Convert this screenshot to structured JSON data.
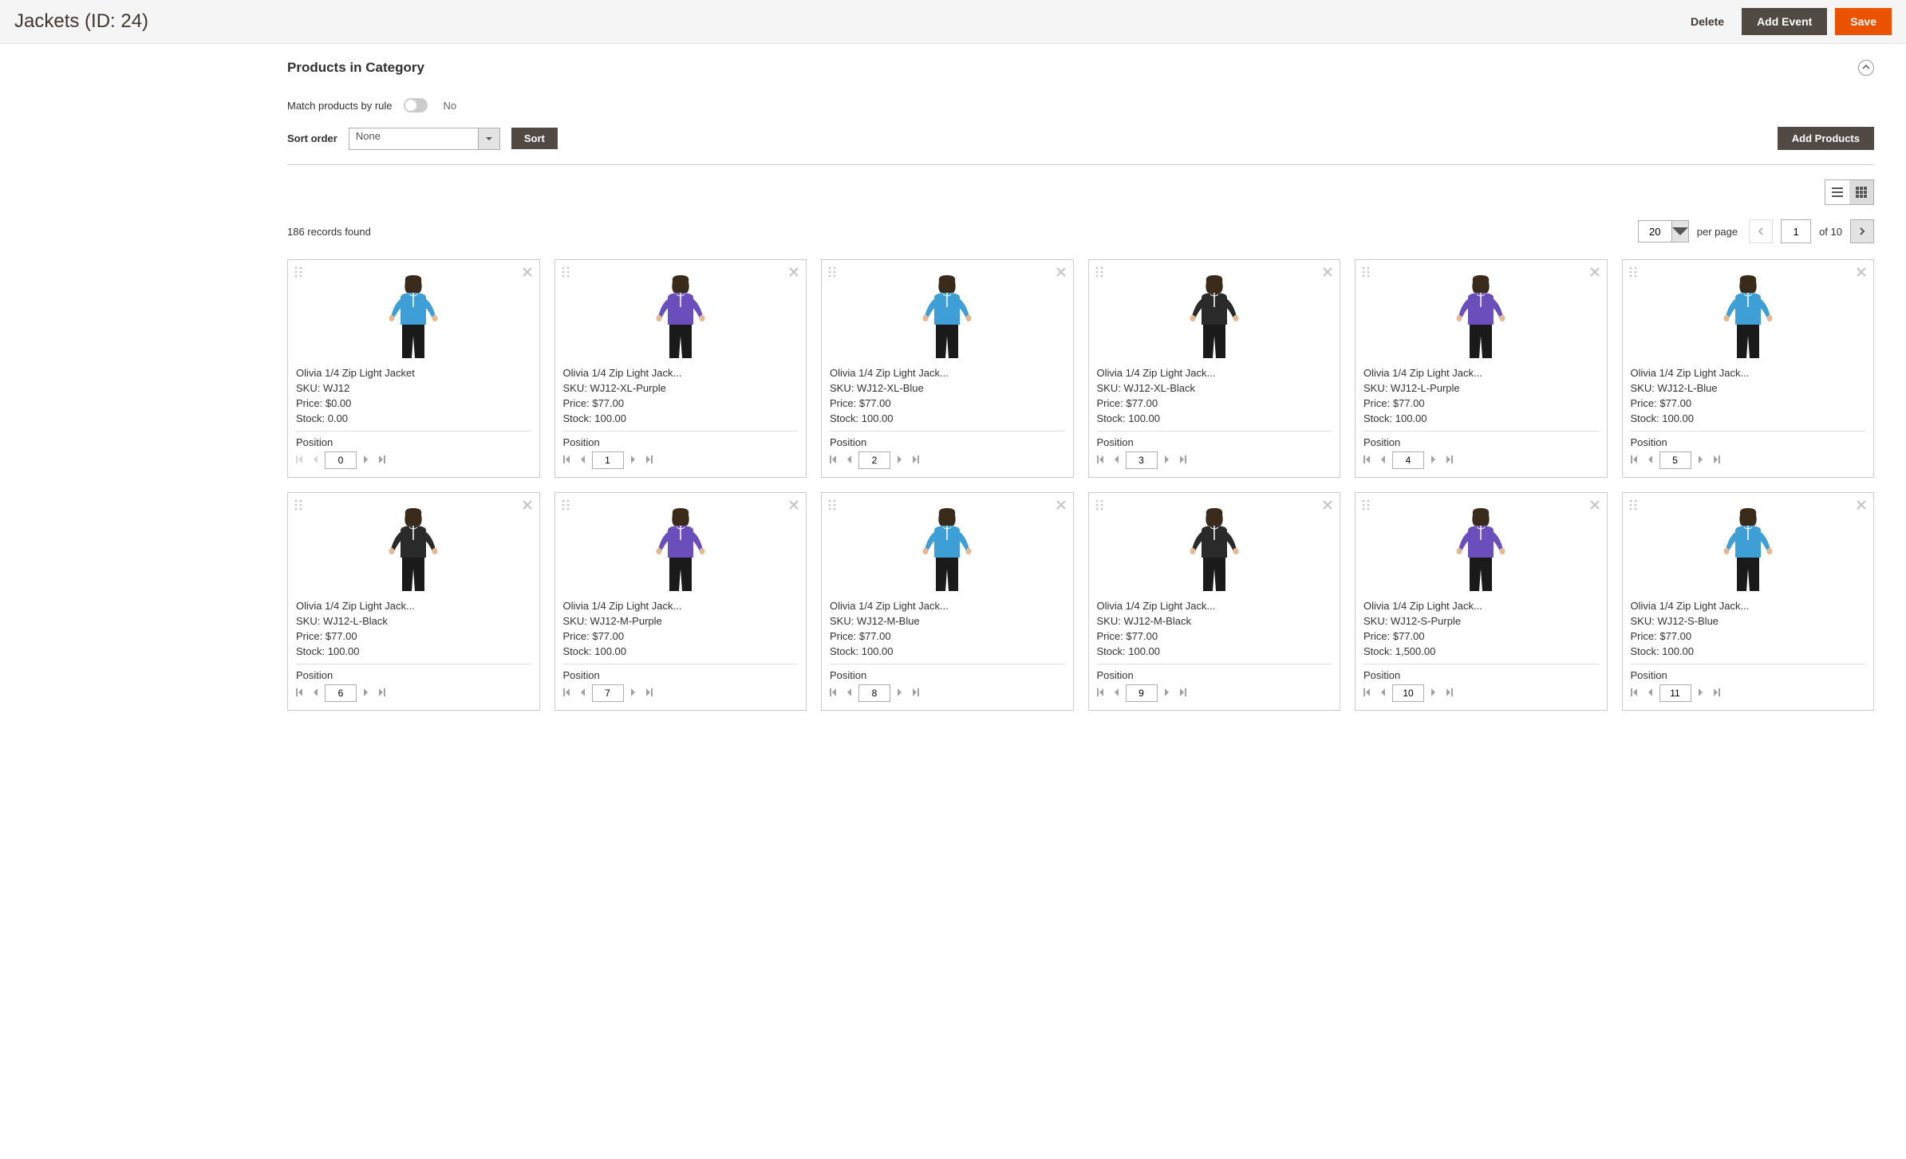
{
  "header": {
    "title": "Jackets (ID: 24)",
    "delete_label": "Delete",
    "add_event_label": "Add Event",
    "save_label": "Save"
  },
  "section": {
    "title": "Products in Category",
    "match_rule_label": "Match products by rule",
    "match_rule_value": "No",
    "sort_order_label": "Sort order",
    "sort_order_value": "None",
    "sort_button": "Sort",
    "add_products_button": "Add Products"
  },
  "pager": {
    "records_found": "186 records found",
    "per_page_value": "20",
    "per_page_label": "per page",
    "current_page": "1",
    "total_pages": "10",
    "of_label": "of"
  },
  "labels": {
    "sku_prefix": "SKU: ",
    "price_prefix": "Price: ",
    "stock_prefix": "Stock: ",
    "position_label": "Position"
  },
  "colors": {
    "blue": "#3d9fd6",
    "purple": "#6a4fbc",
    "black": "#2a2a2a",
    "skin": "#e6b890",
    "hair": "#3a2a1a",
    "pants": "#1a1a1a"
  },
  "products": [
    {
      "name": "Olivia 1/4 Zip Light Jacket",
      "sku": "WJ12",
      "price": "$0.00",
      "stock": "0.00",
      "position": "0",
      "color": "blue"
    },
    {
      "name": "Olivia 1/4 Zip Light Jack...",
      "sku": "WJ12-XL-Purple",
      "price": "$77.00",
      "stock": "100.00",
      "position": "1",
      "color": "purple"
    },
    {
      "name": "Olivia 1/4 Zip Light Jack...",
      "sku": "WJ12-XL-Blue",
      "price": "$77.00",
      "stock": "100.00",
      "position": "2",
      "color": "blue"
    },
    {
      "name": "Olivia 1/4 Zip Light Jack...",
      "sku": "WJ12-XL-Black",
      "price": "$77.00",
      "stock": "100.00",
      "position": "3",
      "color": "black"
    },
    {
      "name": "Olivia 1/4 Zip Light Jack...",
      "sku": "WJ12-L-Purple",
      "price": "$77.00",
      "stock": "100.00",
      "position": "4",
      "color": "purple"
    },
    {
      "name": "Olivia 1/4 Zip Light Jack...",
      "sku": "WJ12-L-Blue",
      "price": "$77.00",
      "stock": "100.00",
      "position": "5",
      "color": "blue"
    },
    {
      "name": "Olivia 1/4 Zip Light Jack...",
      "sku": "WJ12-L-Black",
      "price": "$77.00",
      "stock": "100.00",
      "position": "6",
      "color": "black"
    },
    {
      "name": "Olivia 1/4 Zip Light Jack...",
      "sku": "WJ12-M-Purple",
      "price": "$77.00",
      "stock": "100.00",
      "position": "7",
      "color": "purple"
    },
    {
      "name": "Olivia 1/4 Zip Light Jack...",
      "sku": "WJ12-M-Blue",
      "price": "$77.00",
      "stock": "100.00",
      "position": "8",
      "color": "blue"
    },
    {
      "name": "Olivia 1/4 Zip Light Jack...",
      "sku": "WJ12-M-Black",
      "price": "$77.00",
      "stock": "100.00",
      "position": "9",
      "color": "black"
    },
    {
      "name": "Olivia 1/4 Zip Light Jack...",
      "sku": "WJ12-S-Purple",
      "price": "$77.00",
      "stock": "1,500.00",
      "position": "10",
      "color": "purple"
    },
    {
      "name": "Olivia 1/4 Zip Light Jack...",
      "sku": "WJ12-S-Blue",
      "price": "$77.00",
      "stock": "100.00",
      "position": "11",
      "color": "blue"
    }
  ]
}
